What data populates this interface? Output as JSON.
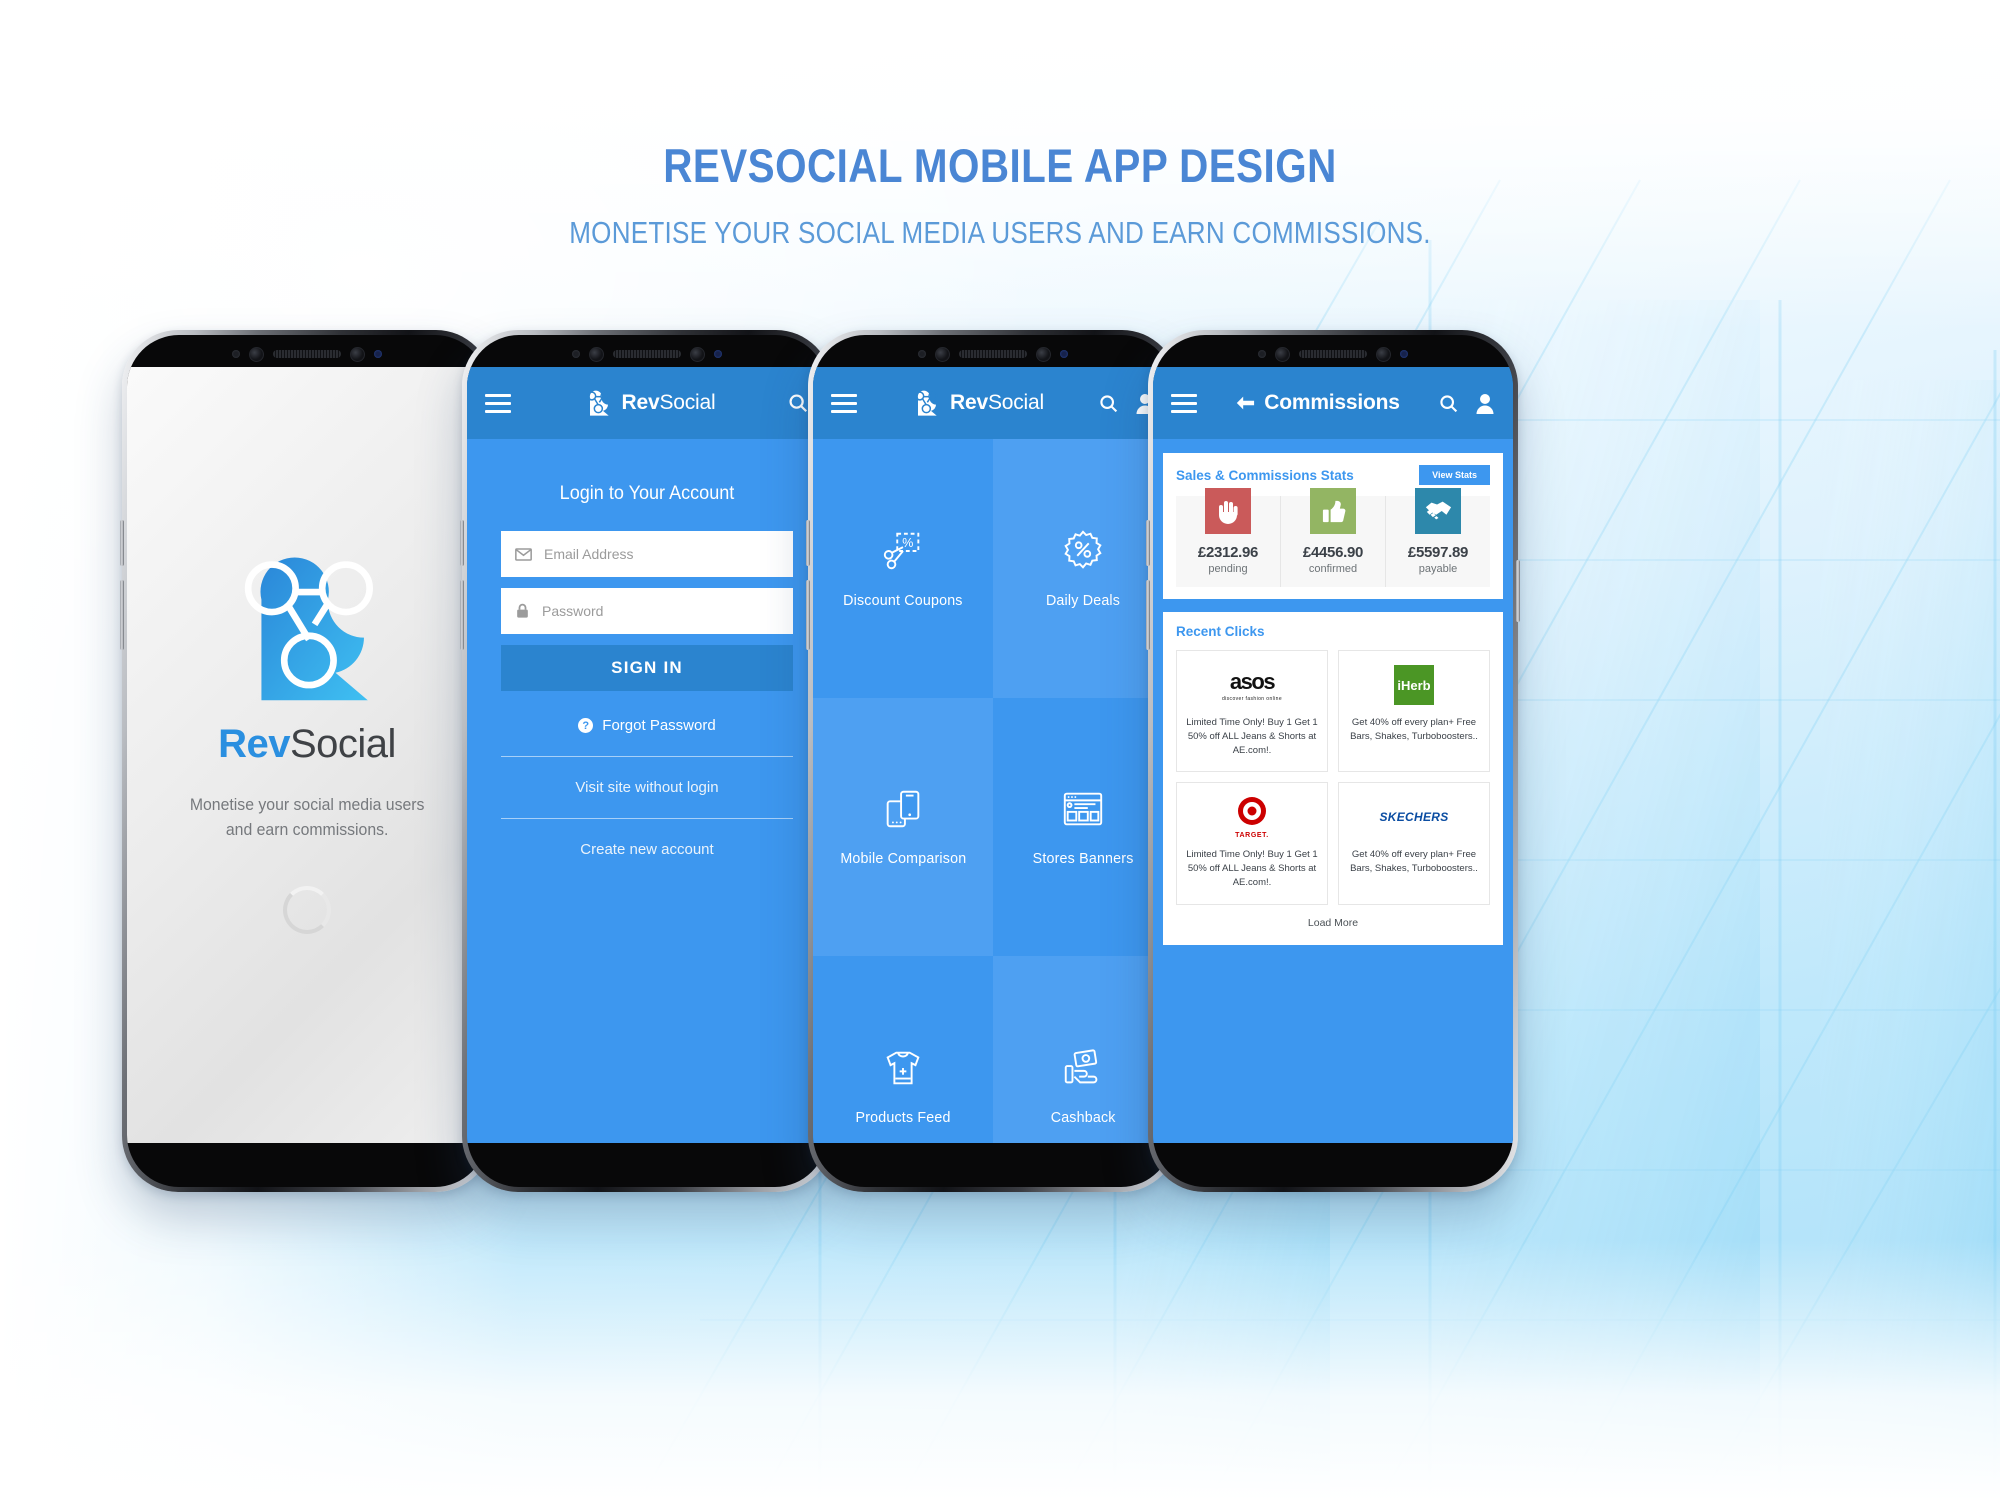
{
  "page": {
    "title": "RevSocial Mobile App Design",
    "subtitle": "Monetise your social media users and earn commissions.",
    "accent_blue": "#3d97ef",
    "accent_blue_dark": "#2b84cf",
    "title_color": "#4a86d4"
  },
  "brand": {
    "name_part1": "Rev",
    "name_part2": "Social",
    "logo_icon": "revsocial-molecule-logo"
  },
  "splash": {
    "brand_rev": "Rev",
    "brand_social": "Social",
    "tagline_line1": "Monetise your social media users",
    "tagline_line2": "and earn commissions.",
    "spinner_icon": "loading-spinner-icon"
  },
  "login": {
    "menu_icon": "hamburger-menu-icon",
    "search_icon": "search-icon",
    "heading": "Login to Your Account",
    "email": {
      "placeholder": "Email Address",
      "value": "",
      "icon": "envelope-icon"
    },
    "password": {
      "placeholder": "Password",
      "value": "",
      "icon": "lock-icon"
    },
    "signin_label": "SIGN IN",
    "forgot_label": "Forgot Password",
    "forgot_icon": "question-circle-icon",
    "visit_label": "Visit site without login",
    "create_label": "Create new account"
  },
  "menu": {
    "menu_icon": "hamburger-menu-icon",
    "search_icon": "search-icon",
    "profile_icon": "user-profile-icon",
    "tiles": [
      {
        "label": "Discount Coupons",
        "icon": "scissors-percent-coupon-icon",
        "shade": "a"
      },
      {
        "label": "Daily Deals",
        "icon": "percent-badge-icon",
        "shade": "b"
      },
      {
        "label": "Mobile Comparison",
        "icon": "two-phones-icon",
        "shade": "b"
      },
      {
        "label": "Stores Banners",
        "icon": "browser-banner-icon",
        "shade": "a"
      },
      {
        "label": "Products Feed",
        "icon": "tshirt-icon",
        "shade": "a"
      },
      {
        "label": "Cashback",
        "icon": "hand-cash-icon",
        "shade": "b"
      }
    ]
  },
  "commissions": {
    "menu_icon": "hamburger-menu-icon",
    "back_icon": "back-arrow-icon",
    "title": "Commissions",
    "search_icon": "search-icon",
    "profile_icon": "user-profile-icon",
    "stats_card_title": "Sales & Commissions Stats",
    "view_stats_label": "View Stats",
    "stats": [
      {
        "amount": "£2312.96",
        "label": "pending",
        "icon": "hand-stop-icon",
        "color": "#ca5a5a"
      },
      {
        "amount": "£4456.90",
        "label": "confirmed",
        "icon": "thumbs-up-icon",
        "color": "#93b563"
      },
      {
        "amount": "£5597.89",
        "label": "payable",
        "icon": "handshake-icon",
        "color": "#2d88ab"
      }
    ],
    "recent_clicks_title": "Recent Clicks",
    "clicks": [
      {
        "logo": "asos-logo",
        "brand": "asos",
        "brand_sub": "discover fashion online",
        "text": "Limited Time Only! Buy 1 Get 1 50% off ALL Jeans & Shorts at AE.com!."
      },
      {
        "logo": "iherb-logo",
        "brand": "iHerb",
        "brand_sub": "",
        "text": "Get 40% off every plan+ Free Bars, Shakes, Turboboosters.."
      },
      {
        "logo": "target-logo",
        "brand": "TARGET.",
        "brand_sub": "",
        "text": "Limited Time Only! Buy 1 Get 1 50% off ALL Jeans & Shorts at AE.com!."
      },
      {
        "logo": "skechers-logo",
        "brand": "SKECHERS",
        "brand_sub": "",
        "text": "Get 40% off every plan+ Free Bars, Shakes, Turboboosters.."
      }
    ],
    "load_more_label": "Load More"
  }
}
